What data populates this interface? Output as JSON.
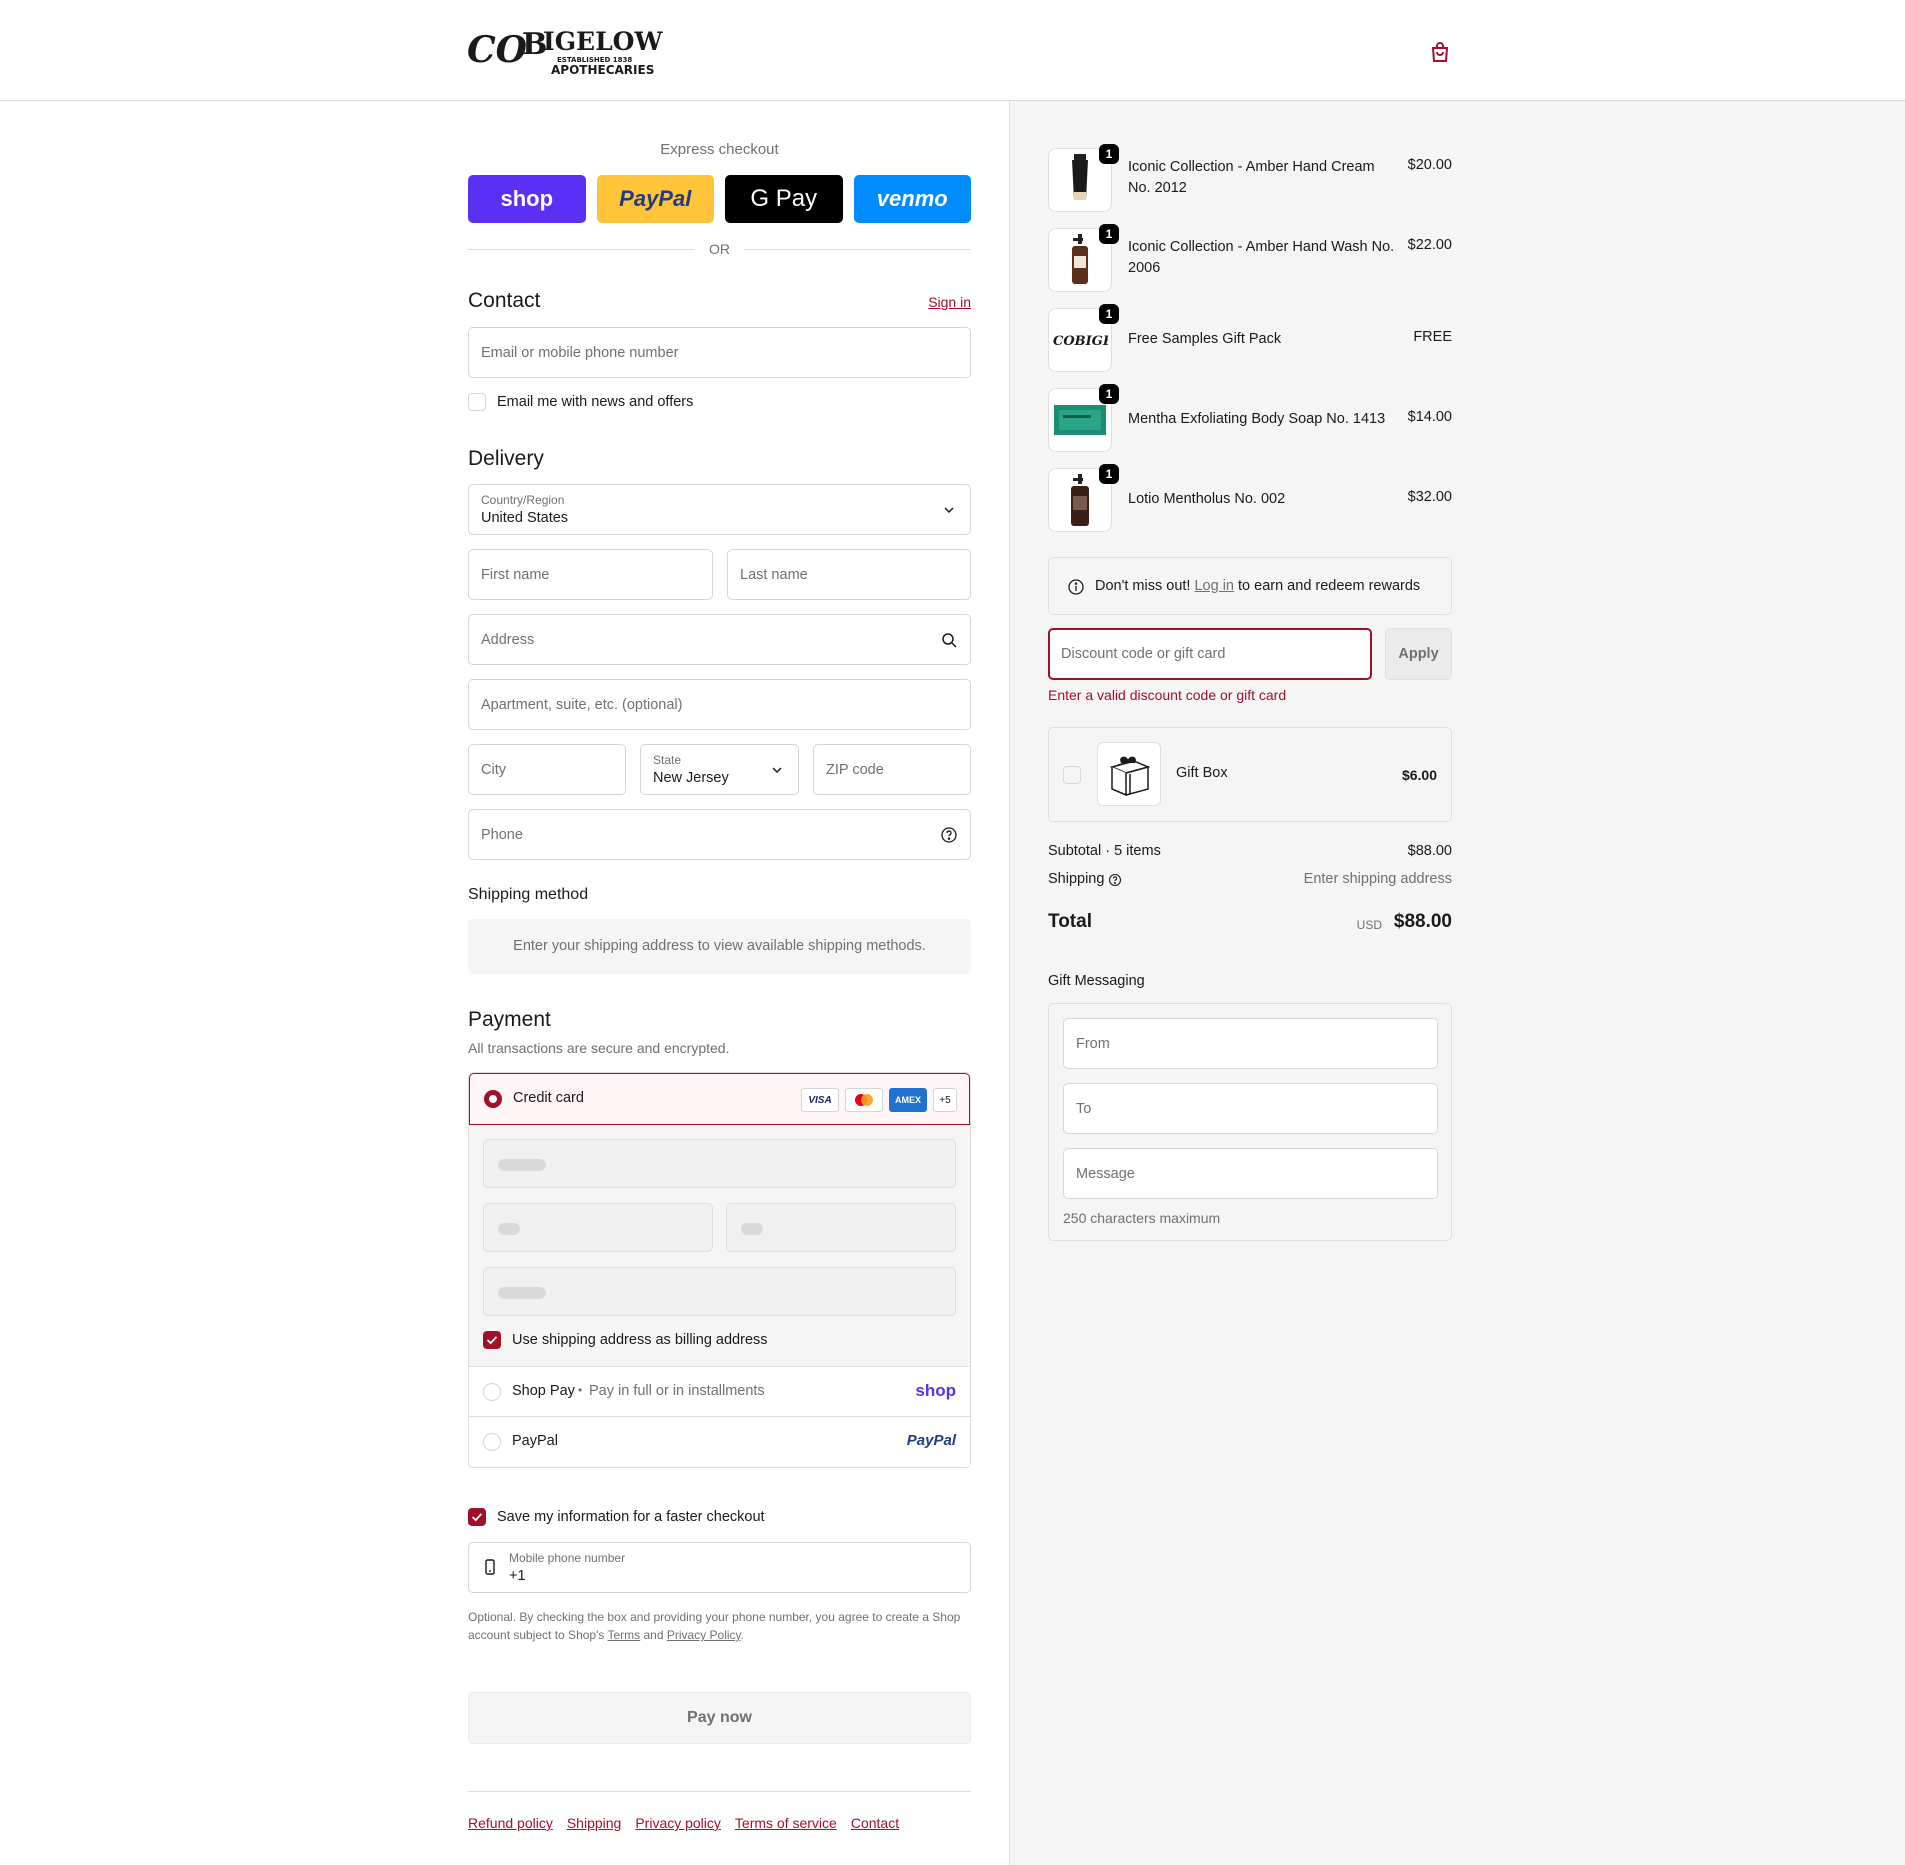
{
  "header": {
    "logo_text": "C.O.BIGELOW",
    "logo_sub1": "ESTABLISHED 1838",
    "logo_sub2": "APOTHECARIES"
  },
  "express": {
    "title": "Express checkout",
    "buttons": [
      "shop",
      "PayPal",
      "G Pay",
      "venmo"
    ],
    "or": "OR"
  },
  "contact": {
    "heading": "Contact",
    "sign_in": "Sign in",
    "email_placeholder": "Email or mobile phone number",
    "news_label": "Email me with news and offers"
  },
  "delivery": {
    "heading": "Delivery",
    "country_label": "Country/Region",
    "country_value": "United States",
    "first_name": "First name",
    "last_name": "Last name",
    "address": "Address",
    "apartment": "Apartment, suite, etc. (optional)",
    "city": "City",
    "state_label": "State",
    "state_value": "New Jersey",
    "zip": "ZIP code",
    "phone": "Phone"
  },
  "shipping": {
    "heading": "Shipping method",
    "note": "Enter your shipping address to view available shipping methods."
  },
  "payment": {
    "heading": "Payment",
    "sub": "All transactions are secure and encrypted.",
    "credit_card": "Credit card",
    "card_brands": [
      "VISA",
      "MC",
      "AMEX",
      "+5"
    ],
    "billing_label": "Use shipping address as billing address",
    "shop_pay": "Shop Pay",
    "shop_pay_sep": "•",
    "shop_pay_sub": "Pay in full or in installments",
    "shop_logo": "shop",
    "paypal": "PayPal",
    "paypal_logo": "PayPal"
  },
  "save_info": {
    "label": "Save my information for a faster checkout",
    "phone_label": "Mobile phone number",
    "phone_value": "+1",
    "legal_1": "Optional. By checking the box and providing your phone number, you agree to create a Shop account subject to Shop's ",
    "terms": "Terms",
    "and": " and ",
    "privacy": "Privacy Policy",
    "period": "."
  },
  "pay_now": "Pay now",
  "footer_links": [
    "Refund policy",
    "Shipping",
    "Privacy policy",
    "Terms of service",
    "Contact"
  ],
  "cart": {
    "items": [
      {
        "name": "Iconic Collection - Amber Hand Cream No. 2012",
        "price": "$20.00",
        "qty": "1"
      },
      {
        "name": "Iconic Collection - Amber Hand Wash No. 2006",
        "price": "$22.00",
        "qty": "1"
      },
      {
        "name": "Free Samples Gift Pack",
        "price": "FREE",
        "qty": "1"
      },
      {
        "name": "Mentha Exfoliating Body Soap No. 1413",
        "price": "$14.00",
        "qty": "1"
      },
      {
        "name": "Lotio Mentholus No. 002",
        "price": "$32.00",
        "qty": "1"
      }
    ],
    "rewards_pre": "Don't miss out! ",
    "rewards_link": "Log in",
    "rewards_post": " to earn and redeem rewards",
    "discount_placeholder": "Discount code or gift card",
    "apply": "Apply",
    "discount_error": "Enter a valid discount code or gift card",
    "gift_box_name": "Gift Box",
    "gift_box_price": "$6.00",
    "subtotal_label": "Subtotal · 5 items",
    "subtotal": "$88.00",
    "shipping_label": "Shipping",
    "shipping_value": "Enter shipping address",
    "total_label": "Total",
    "currency": "USD",
    "total": "$88.00"
  },
  "gift_messaging": {
    "heading": "Gift Messaging",
    "from": "From",
    "to": "To",
    "message": "Message",
    "limit": "250 characters maximum"
  },
  "colors": {
    "accent": "#a0102b",
    "shop": "#5a31f4",
    "paypal": "#ffc439",
    "venmo": "#008cff"
  }
}
